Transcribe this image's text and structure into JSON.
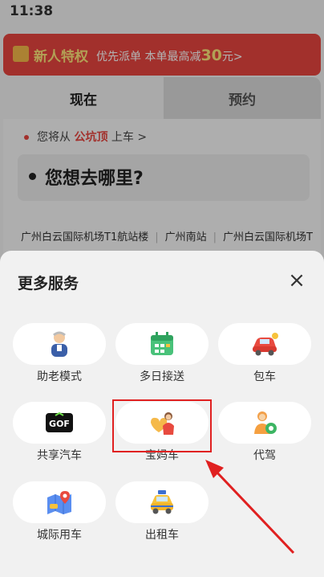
{
  "statusbar": {
    "time": "11:38"
  },
  "promo": {
    "title": "新人特权",
    "sub_prefix": "优先派单 本单最高减",
    "amount": "30",
    "suffix": "元>"
  },
  "tabs": {
    "now": "现在",
    "reserve": "预约"
  },
  "pickup": {
    "prefix": "您将从",
    "location": "公坑顶",
    "suffix": "上车 >"
  },
  "destination": {
    "placeholder": "您想去哪里?"
  },
  "shortcuts": [
    "广州白云国际机场T1航站楼",
    "广州南站",
    "广州白云国际机场T"
  ],
  "sheet": {
    "title": "更多服务",
    "services": [
      {
        "label": "助老模式",
        "icon": "elderly-person-icon"
      },
      {
        "label": "多日接送",
        "icon": "calendar-icon"
      },
      {
        "label": "包车",
        "icon": "red-car-icon"
      },
      {
        "label": "共享汽车",
        "icon": "gofun-logo-icon"
      },
      {
        "label": "宝妈车",
        "icon": "mom-heart-icon"
      },
      {
        "label": "代驾",
        "icon": "chauffeur-icon"
      },
      {
        "label": "城际用车",
        "icon": "map-pin-icon"
      },
      {
        "label": "出租车",
        "icon": "taxi-icon"
      }
    ]
  },
  "colors": {
    "accent": "#e8463f",
    "highlight": "#e02020",
    "promo_yellow": "#ffe57a"
  }
}
